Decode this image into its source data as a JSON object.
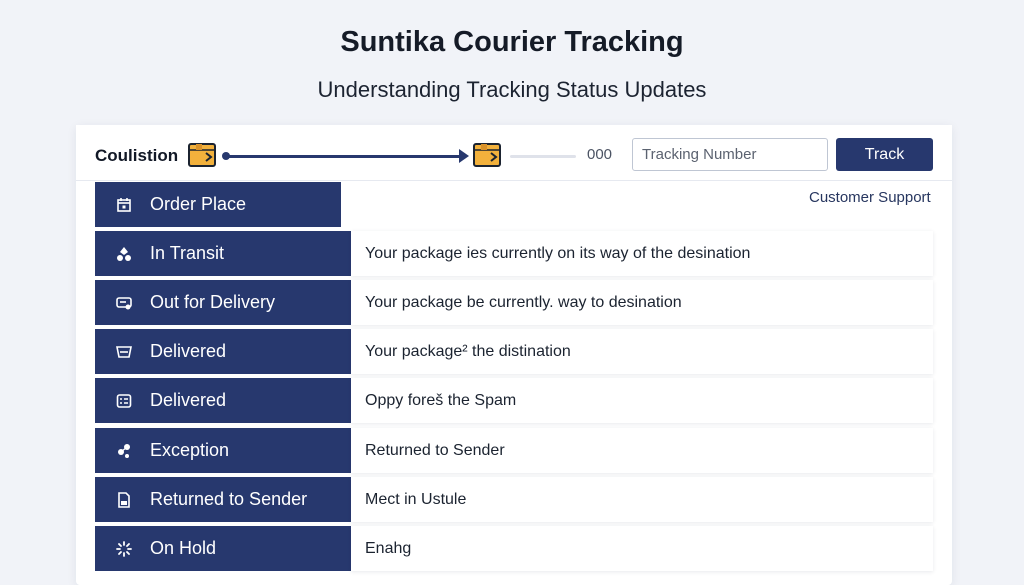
{
  "header": {
    "title": "Suntika Courier Tracking",
    "subtitle": "Understanding Tracking Status Updates"
  },
  "toolbar": {
    "label": "Coulistion",
    "counter": "000",
    "tracking_input": {
      "value": "",
      "placeholder": "Tracking Number"
    },
    "track_button": "Track",
    "progress_icon": "package-box-icon"
  },
  "support_link": "Customer Support",
  "colors": {
    "accent": "#27386e",
    "box_orange": "#f2b13c",
    "background": "#f1f3f8"
  },
  "statuses": [
    {
      "label": "Order Place",
      "icon": "calendar-icon",
      "description": ""
    },
    {
      "label": "In Transit",
      "icon": "route-icon",
      "description": "Your package ies currently on its way of the desination"
    },
    {
      "label": "Out for Delivery",
      "icon": "delivery-truck-icon",
      "description": "Your package be currently. way to desination"
    },
    {
      "label": "Delivered",
      "icon": "inbox-icon",
      "description": "Your package² the distination"
    },
    {
      "label": "Delivered",
      "icon": "checklist-icon",
      "description": "Oppy foreš the Spam"
    },
    {
      "label": "Exception",
      "icon": "alert-nodes-icon",
      "description": "Returned to Sender"
    },
    {
      "label": "Returned to Sender",
      "icon": "document-icon",
      "description": "Mect in Ustule"
    },
    {
      "label": "On Hold",
      "icon": "spinner-icon",
      "description": "Enahg"
    }
  ]
}
